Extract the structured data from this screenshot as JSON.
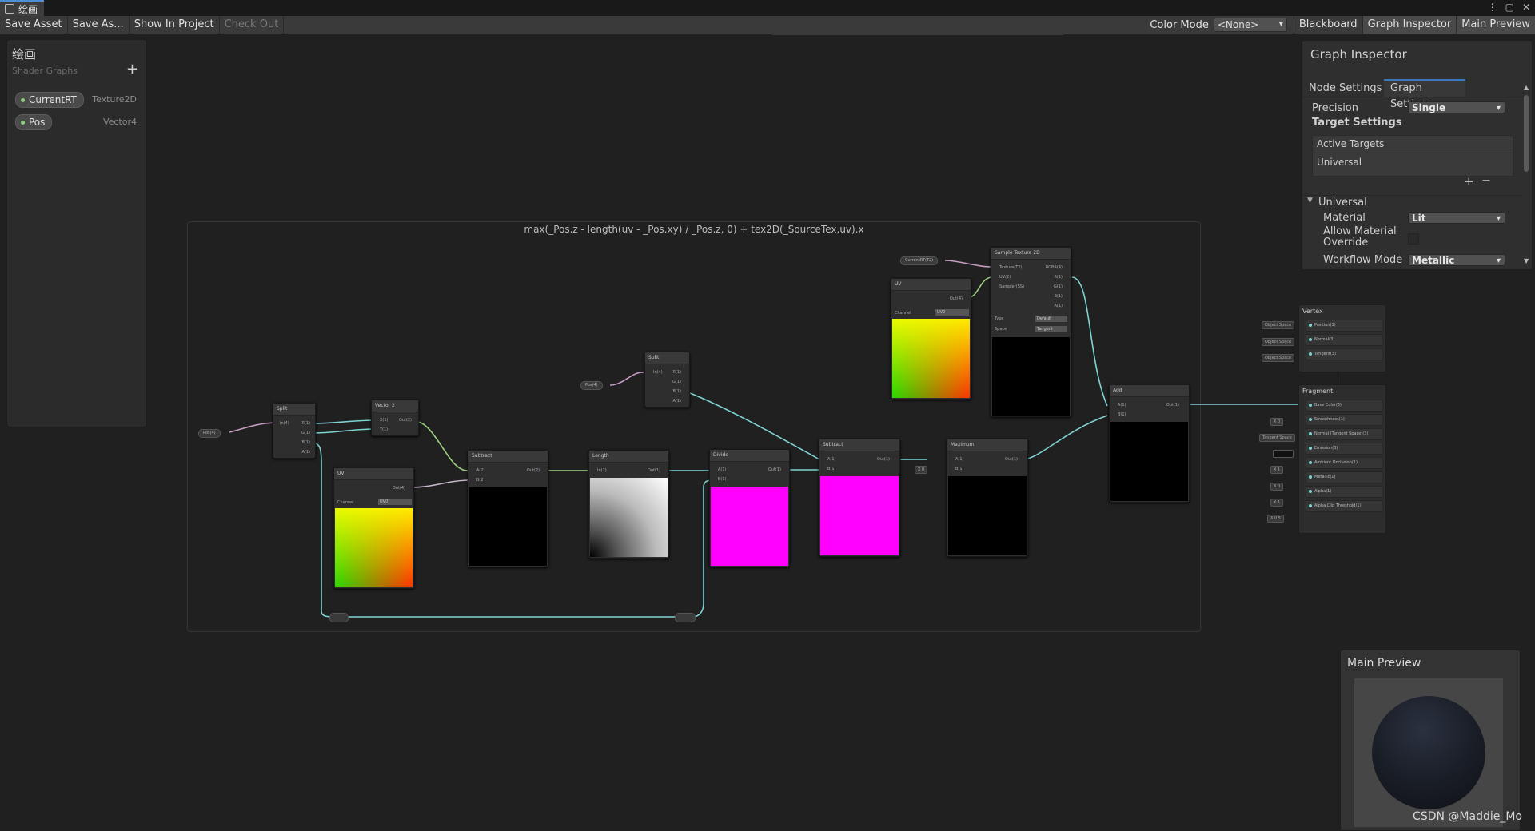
{
  "window": {
    "tab_title": "绘画",
    "controls": [
      "⋮",
      "▢",
      "✕"
    ]
  },
  "toolbar": {
    "save_asset": "Save Asset",
    "save_as": "Save As...",
    "show_in_project": "Show In Project",
    "check_out": "Check Out",
    "color_mode_label": "Color Mode",
    "color_mode_value": "<None>",
    "blackboard": "Blackboard",
    "graph_inspector": "Graph Inspector",
    "main_preview": "Main Preview"
  },
  "blackboard": {
    "title": "绘画",
    "subtitle": "Shader Graphs",
    "add": "+",
    "properties": [
      {
        "name": "CurrentRT",
        "type": "Texture2D"
      },
      {
        "name": "Pos",
        "type": "Vector4"
      }
    ]
  },
  "group": {
    "title": "max(_Pos.z - length(uv - _Pos.xy) / _Pos.z, 0) + tex2D(_SourceTex,uv).x"
  },
  "nodes": {
    "pos_prop1": "Pos(4)",
    "split1": {
      "title": "Split",
      "in": "In(4)",
      "outs": [
        "R(1)",
        "G(1)",
        "B(1)",
        "A(1)"
      ]
    },
    "vector2": {
      "title": "Vector 2",
      "ins": [
        "X(1)",
        "Y(1)"
      ],
      "out": "Out(2)"
    },
    "uv1": {
      "title": "UV",
      "out": "Out(4)",
      "channel_label": "Channel",
      "channel": "UV0"
    },
    "subtract1": {
      "title": "Subtract",
      "ins": [
        "A(2)",
        "B(2)"
      ],
      "out": "Out(2)"
    },
    "length": {
      "title": "Length",
      "in": "In(2)",
      "out": "Out(1)"
    },
    "pos_prop2": "Pos(4)",
    "split2": {
      "title": "Split",
      "in": "In(4)",
      "outs": [
        "R(1)",
        "G(1)",
        "B(1)",
        "A(1)"
      ]
    },
    "divide": {
      "title": "Divide",
      "ins": [
        "A(1)",
        "B(1)"
      ],
      "out": "Out(1)"
    },
    "subtract2": {
      "title": "Subtract",
      "ins": [
        "A(1)",
        "B(1)"
      ],
      "out": "Out(1)"
    },
    "maximum": {
      "title": "Maximum",
      "ins": [
        "A(1)",
        "B(1)"
      ],
      "out": "Out(1)",
      "b_value": "0",
      "b_label": "X"
    },
    "currentrt_prop": "CurrentRT(T2)",
    "uv2": {
      "title": "UV",
      "out": "Out(4)",
      "channel_label": "Channel",
      "channel": "UV0"
    },
    "sample_tex": {
      "title": "Sample Texture 2D",
      "ins": [
        "Texture(T2)",
        "UV(2)",
        "Sampler(SS)"
      ],
      "outs": [
        "RGBA(4)",
        "R(1)",
        "G(1)",
        "B(1)",
        "A(1)"
      ],
      "type_label": "Type",
      "type": "Default",
      "space_label": "Space",
      "space": "Tangent"
    },
    "add": {
      "title": "Add",
      "ins": [
        "A(1)",
        "B(1)"
      ],
      "out": "Out(1)"
    }
  },
  "master": {
    "vertex_title": "Vertex",
    "vertex_slots": [
      "Position(3)",
      "Normal(3)",
      "Tangent(3)"
    ],
    "vertex_defaults": [
      "Object Space",
      "Object Space",
      "Object Space"
    ],
    "fragment_title": "Fragment",
    "fragment_slots": [
      "Base Color(3)",
      "Smoothness(1)",
      "Normal (Tangent Space)(3)",
      "Emission(3)",
      "Ambient Occlusion(1)",
      "Metallic(1)",
      "Alpha(1)",
      "Alpha Clip Threshold(1)"
    ],
    "fragment_defaults": [
      "",
      "X 0",
      "Tangent Space",
      "",
      "X 1",
      "X 0",
      "X 1",
      "X 0.5"
    ]
  },
  "inspector": {
    "title": "Graph Inspector",
    "tabs": [
      "Node Settings",
      "Graph Settings"
    ],
    "precision_label": "Precision",
    "precision": "Single",
    "target_settings": "Target Settings",
    "active_targets": "Active Targets",
    "target_item": "Universal",
    "plus": "+",
    "minus": "−",
    "section": "Universal",
    "material_label": "Material",
    "material": "Lit",
    "allow_override_label": "Allow Material Override",
    "workflow_label": "Workflow Mode",
    "workflow": "Metallic"
  },
  "preview": {
    "title": "Main Preview"
  },
  "watermark": "CSDN @Maddie_Mo"
}
